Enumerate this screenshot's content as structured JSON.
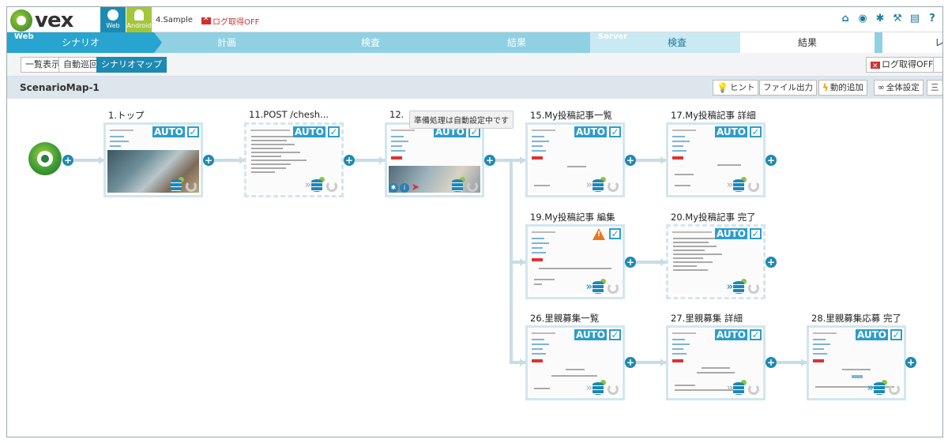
{
  "header": {
    "logo": "vex",
    "platforms": [
      {
        "label": "Web",
        "icon": "globe-icon"
      },
      {
        "label": "Android",
        "icon": "android-icon"
      }
    ],
    "project": "4.Sample",
    "log_status": "ログ取得OFF",
    "icons": [
      "home-icon",
      "dashboard-icon",
      "gear-icon",
      "wrench-icon",
      "book-icon",
      "help-icon"
    ]
  },
  "process_bar": {
    "web_tag": "Web",
    "server_tag": "Server",
    "web_steps": [
      "シナリオ",
      "計画",
      "検査",
      "結果"
    ],
    "server_steps": [
      "検査",
      "結果",
      "レ"
    ]
  },
  "tabs": {
    "items": [
      "一覧表示",
      "自動巡回",
      "シナリオマップ"
    ],
    "active": "シナリオマップ",
    "log_button": "ログ取得OFF"
  },
  "map_header": {
    "title": "ScenarioMap-1",
    "buttons": [
      "ヒント",
      "ファイル出力",
      "動的追加",
      "全体設定",
      "三"
    ]
  },
  "tooltip": "準備処理は自動設定中です",
  "nodes": [
    {
      "id": "n1",
      "title": "1.トップ",
      "badge": "AUTO"
    },
    {
      "id": "n11",
      "title": "11.POST /chesh...",
      "badge": "AUTO"
    },
    {
      "id": "n12",
      "title": "12.",
      "badge": "AUTO"
    },
    {
      "id": "n15",
      "title": "15.My投稿記事一覧",
      "badge": "AUTO"
    },
    {
      "id": "n17",
      "title": "17.My投稿記事 詳細",
      "badge": "AUTO"
    },
    {
      "id": "n19",
      "title": "19.My投稿記事 編集",
      "badge": ""
    },
    {
      "id": "n20",
      "title": "20.My投稿記事 完了",
      "badge": "AUTO"
    },
    {
      "id": "n26",
      "title": "26.里親募集一覧",
      "badge": "AUTO"
    },
    {
      "id": "n27",
      "title": "27.里親募集 詳細",
      "badge": "AUTO"
    },
    {
      "id": "n28",
      "title": "28.里親募集応募 完了",
      "badge": "AUTO"
    }
  ]
}
